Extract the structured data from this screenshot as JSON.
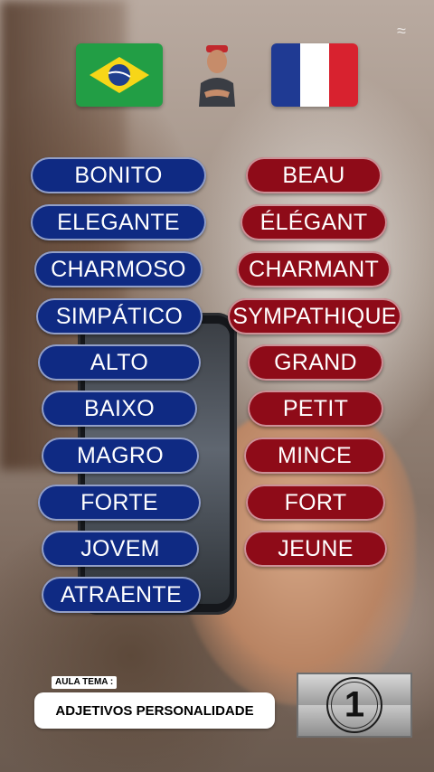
{
  "header": {
    "left_flag": "brazil-flag-icon",
    "right_flag": "france-flag-icon",
    "avatar": "teacher-avatar"
  },
  "colors": {
    "portuguese_pill": "#0f2a83",
    "french_pill": "#8e0b18"
  },
  "words": {
    "portuguese": [
      "BONITO",
      "ELEGANTE",
      "CHARMOSO",
      "SIMPÁTICO",
      "ALTO",
      "BAIXO",
      "MAGRO",
      "FORTE",
      "JOVEM",
      "ATRAENTE"
    ],
    "french": [
      "BEAU",
      "ÉLÉGANT",
      "CHARMANT",
      "SYMPATHIQUE",
      "GRAND",
      "PETIT",
      "MINCE",
      "FORT",
      "JEUNE"
    ]
  },
  "footer": {
    "tema_label": "AULA TEMA :",
    "tema_value": "ADJETIVOS PERSONALIDADE",
    "lesson_number": "1"
  }
}
